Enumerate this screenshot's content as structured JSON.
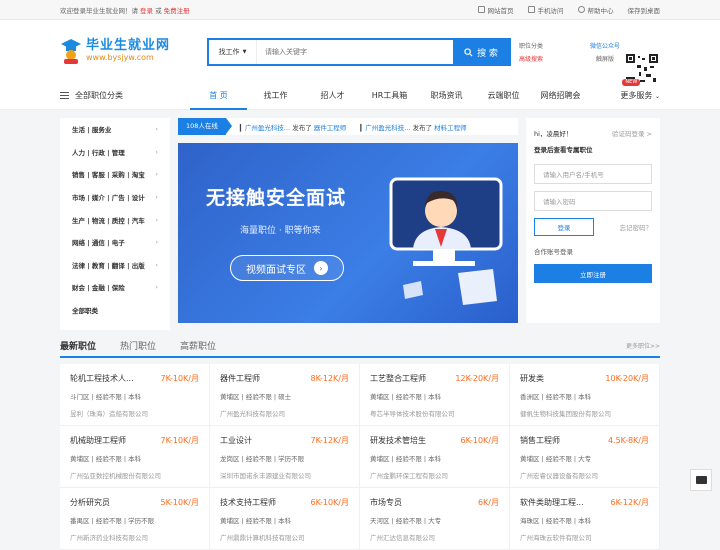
{
  "topbar": {
    "welcome": "欢迎登录毕业生就业网！请",
    "login": "登录",
    "or": "或",
    "register": "免费注册",
    "links": [
      "网站首页",
      "手机访问",
      "帮助中心",
      "保存到桌面"
    ]
  },
  "logo": {
    "name": "毕业生就业网",
    "url": "www.bysjyw.com"
  },
  "search": {
    "type": "找工作",
    "placeholder": "请输入关键字",
    "button": "搜 索"
  },
  "header": {
    "link1": "职位分类",
    "link2": "高级搜索",
    "wx1": "微信公众号",
    "wx2": "触屏版"
  },
  "nav": {
    "category": "全部职位分类",
    "items": [
      "首 页",
      "找工作",
      "招人才",
      "HR工具箱",
      "职场资讯",
      "云端职位",
      "网络招聘会"
    ],
    "more": "更多服务",
    "new": "NEW"
  },
  "sidebar": [
    "生活 | 服务业",
    "人力 | 行政 | 管理",
    "销售 | 客服 | 采购 | 淘宝",
    "市场 | 媒介 | 广告 | 设计",
    "生产 | 物流 | 质控 | 汽车",
    "网络 | 通信 | 电子",
    "法律 | 教育 | 翻译 | 出版",
    "财会 | 金融 | 保险",
    "全部职类"
  ],
  "ticker": {
    "online": "108人在线",
    "m1_co": "广州盈光科技...",
    "m1_mid": "发布了",
    "m1_job": "器件工程师",
    "m2_co": "广州盈光科技...",
    "m2_mid": "发布了",
    "m2_job": "材料工程师"
  },
  "banner": {
    "title": "无接触安全面试",
    "sub": "海量职位 · 职等你来",
    "pill": "视频面试专区",
    "arrow": "›"
  },
  "login": {
    "hi": "hi，凌晨好！",
    "code": "验证码登录 >",
    "after": "登录后查看专属职位",
    "user": "请输入用户名/手机号",
    "pwd": "请输入密码",
    "btn": "登录",
    "forgot": "忘记密码？",
    "coop": "合作账号登录",
    "reg": "立即注册"
  },
  "tabs": {
    "items": [
      "最新职位",
      "热门职位",
      "高薪职位"
    ],
    "more": "更多职位>>"
  },
  "jobs": [
    {
      "title": "轮机工程技术人...",
      "salary": "7K-10K/月",
      "req": "斗门区 | 经验不限 | 本科",
      "company": "昱利（珠海）造船有限公司"
    },
    {
      "title": "器件工程师",
      "salary": "8K-12K/月",
      "req": "黄埔区 | 经验不限 | 硕士",
      "company": "广州盈光科技有限公司"
    },
    {
      "title": "工艺整合工程师",
      "salary": "12K-20K/月",
      "req": "黄埔区 | 经验不限 | 本科",
      "company": "粤芯半导体技术股份有限公司"
    },
    {
      "title": "研发类",
      "salary": "10K-20K/月",
      "req": "香洲区 | 经验不限 | 本科",
      "company": "健帆生物科技集团股份有限公司"
    },
    {
      "title": "机械助理工程师",
      "salary": "7K-10K/月",
      "req": "黄埔区 | 经验不限 | 本科",
      "company": "广州弘亚数控机械股份有限公司"
    },
    {
      "title": "工业设计",
      "salary": "7K-12K/月",
      "req": "龙岗区 | 经验不限 | 学历不限",
      "company": "深圳市国诺永丰源建业有限公司"
    },
    {
      "title": "研发技术管培生",
      "salary": "6K-10K/月",
      "req": "黄埔区 | 经验不限 | 本科",
      "company": "广州金鹏环保工程有限公司"
    },
    {
      "title": "销售工程师",
      "salary": "4.5K-8K/月",
      "req": "黄埔区 | 经验不限 | 大专",
      "company": "广州宏睿仪器设备有限公司"
    },
    {
      "title": "分析研究员",
      "salary": "5K-10K/月",
      "req": "番禺区 | 经验不限 | 学历不限",
      "company": "广州新济药业科技有限公司"
    },
    {
      "title": "技术支持工程师",
      "salary": "6K-10K/月",
      "req": "黄埔区 | 经验不限 | 本科",
      "company": "广州鼎鼎计算机科技有限公司"
    },
    {
      "title": "市场专员",
      "salary": "6K/月",
      "req": "天河区 | 经验不限 | 大专",
      "company": "广州汇达信息有限公司"
    },
    {
      "title": "软件类助理工程...",
      "salary": "6K-12K/月",
      "req": "海珠区 | 经验不限 | 本科",
      "company": "广州海珠云软件有限公司"
    }
  ],
  "colors": {
    "brand": "#1b7fe3",
    "salary": "#ff6a1a",
    "accent_red": "#e5383b"
  }
}
